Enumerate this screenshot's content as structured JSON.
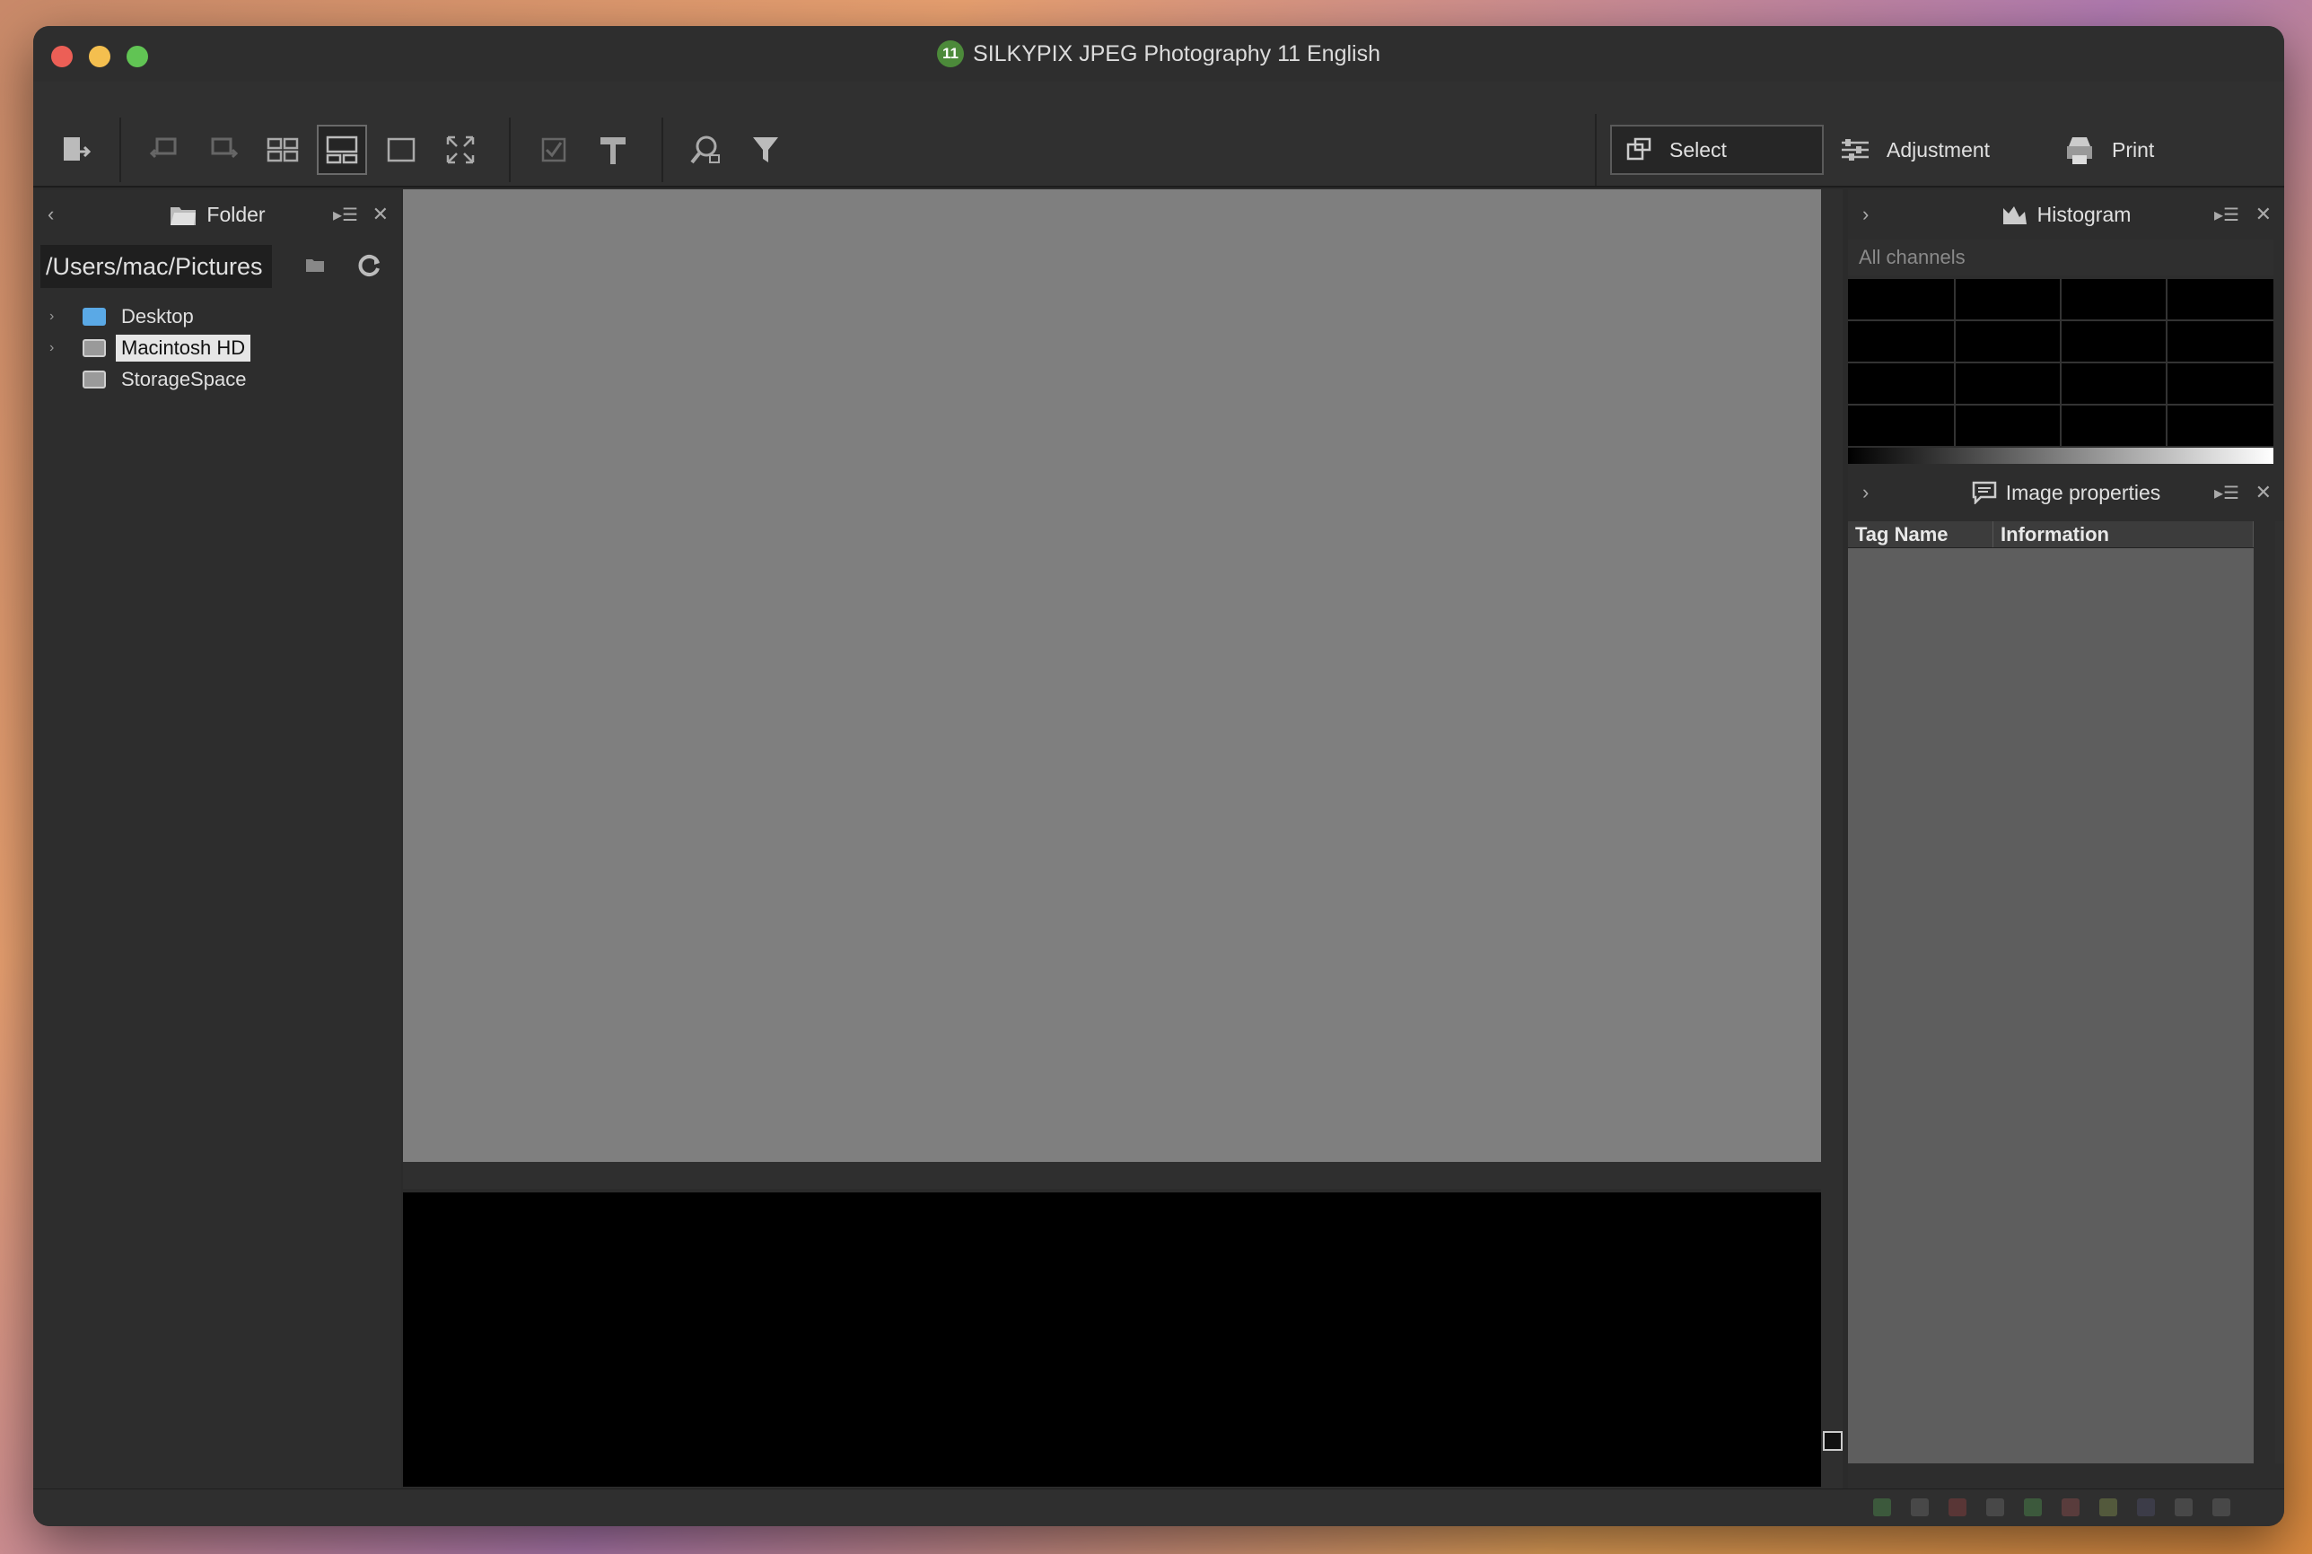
{
  "window": {
    "title": "SILKYPIX JPEG Photography 11 English",
    "badge": "11"
  },
  "toolbar": {
    "buttons": [
      {
        "name": "export-icon"
      },
      {
        "name": "undo-icon"
      },
      {
        "name": "redo-icon"
      },
      {
        "name": "grid-view-icon"
      },
      {
        "name": "filmstrip-view-icon",
        "active": true
      },
      {
        "name": "single-view-icon"
      },
      {
        "name": "fullscreen-icon"
      },
      {
        "name": "checkbox-icon"
      },
      {
        "name": "hammer-icon"
      },
      {
        "name": "search-icon"
      },
      {
        "name": "filter-icon"
      }
    ],
    "modes": {
      "select": "Select",
      "adjustment": "Adjustment",
      "print": "Print"
    }
  },
  "folder_panel": {
    "title": "Folder",
    "path": "/Users/mac/Pictures",
    "tree": [
      {
        "label": "Desktop",
        "icon": "folder-icon",
        "expandable": true,
        "selected": false
      },
      {
        "label": "Macintosh HD",
        "icon": "disk-icon",
        "expandable": true,
        "selected": true
      },
      {
        "label": "StorageSpace",
        "icon": "disk-icon",
        "expandable": false,
        "selected": false
      }
    ]
  },
  "histogram_panel": {
    "title": "Histogram",
    "channel": "All channels"
  },
  "properties_panel": {
    "title": "Image properties",
    "columns": [
      "Tag Name",
      "Information"
    ]
  },
  "colors": {
    "window_bg": "#2b2b2b",
    "preview_bg": "#7f7f7f",
    "filmstrip_bg": "#000000",
    "props_bg": "#5e5e5e",
    "selected_bg": "#e6e6e6"
  }
}
